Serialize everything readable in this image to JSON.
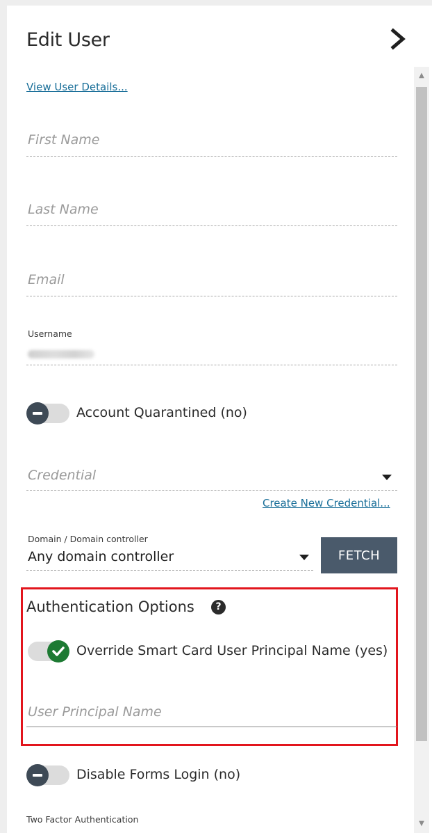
{
  "header": {
    "title": "Edit User",
    "collapse_icon": "chevron-right-icon"
  },
  "links": {
    "view_details": "View User Details...",
    "create_credential": "Create New Credential..."
  },
  "fields": {
    "first_name_placeholder": "First Name",
    "last_name_placeholder": "Last Name",
    "email_placeholder": "Email",
    "username_label": "Username",
    "credential_placeholder": "Credential",
    "domain_label": "Domain / Domain controller",
    "domain_value": "Any domain controller",
    "upn_placeholder": "User Principal Name"
  },
  "toggles": {
    "account_quarantined": {
      "label": "Account Quarantined (no)",
      "on": false
    },
    "override_smart_card": {
      "label": "Override Smart Card User Principal Name (yes)",
      "on": true
    },
    "disable_forms_login": {
      "label": "Disable Forms Login (no)",
      "on": false
    }
  },
  "buttons": {
    "fetch": "FETCH"
  },
  "sections": {
    "auth_options_title": "Authentication Options",
    "two_factor_label": "Two Factor Authentication"
  },
  "colors": {
    "link": "#1a6f99",
    "toggle_on": "#1d7a33",
    "toggle_off": "#3e4a56",
    "highlight": "#e2151d",
    "fetch_button": "#4a5a6b"
  }
}
